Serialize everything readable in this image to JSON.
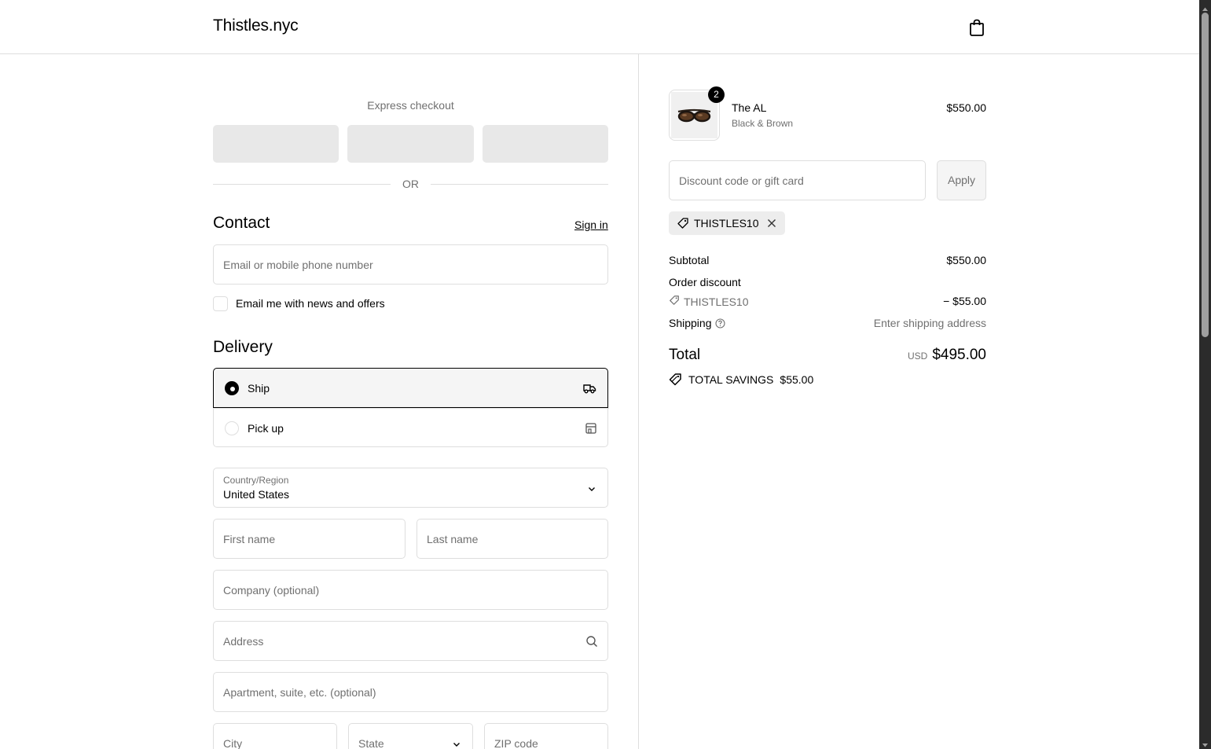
{
  "header": {
    "brand": "Thistles.nyc",
    "cart_icon": "shopping-bag-icon"
  },
  "express": {
    "title": "Express checkout",
    "separator": "OR"
  },
  "contact": {
    "heading": "Contact",
    "sign_in": "Sign in",
    "email_placeholder": "Email or mobile phone number",
    "newsletter_label": "Email me with news and offers",
    "newsletter_checked": false
  },
  "delivery": {
    "heading": "Delivery",
    "options": [
      {
        "label": "Ship",
        "selected": true,
        "icon": "truck-icon"
      },
      {
        "label": "Pick up",
        "selected": false,
        "icon": "store-icon"
      }
    ],
    "country_label": "Country/Region",
    "country_value": "United States",
    "first_name_placeholder": "First name",
    "last_name_placeholder": "Last name",
    "company_placeholder": "Company (optional)",
    "address_placeholder": "Address",
    "apartment_placeholder": "Apartment, suite, etc. (optional)",
    "city_placeholder": "City",
    "state_placeholder": "State",
    "zip_placeholder": "ZIP code"
  },
  "summary": {
    "product": {
      "name": "The AL",
      "variant": "Black & Brown",
      "price": "$550.00",
      "quantity": "2"
    },
    "discount_placeholder": "Discount code or gift card",
    "apply_label": "Apply",
    "applied_code": "THISTLES10",
    "subtotal_label": "Subtotal",
    "subtotal_value": "$550.00",
    "order_discount_label": "Order discount",
    "discount_code": "THISTLES10",
    "discount_value": "− $55.00",
    "shipping_label": "Shipping",
    "shipping_value": "Enter shipping address",
    "total_label": "Total",
    "total_currency": "USD",
    "total_value": "$495.00",
    "savings_label": "TOTAL SAVINGS",
    "savings_value": "$55.00"
  },
  "colors": {
    "border": "#dedede",
    "muted": "#707070",
    "express_button": "#e8e8e8",
    "tag_bg": "#ededed"
  }
}
